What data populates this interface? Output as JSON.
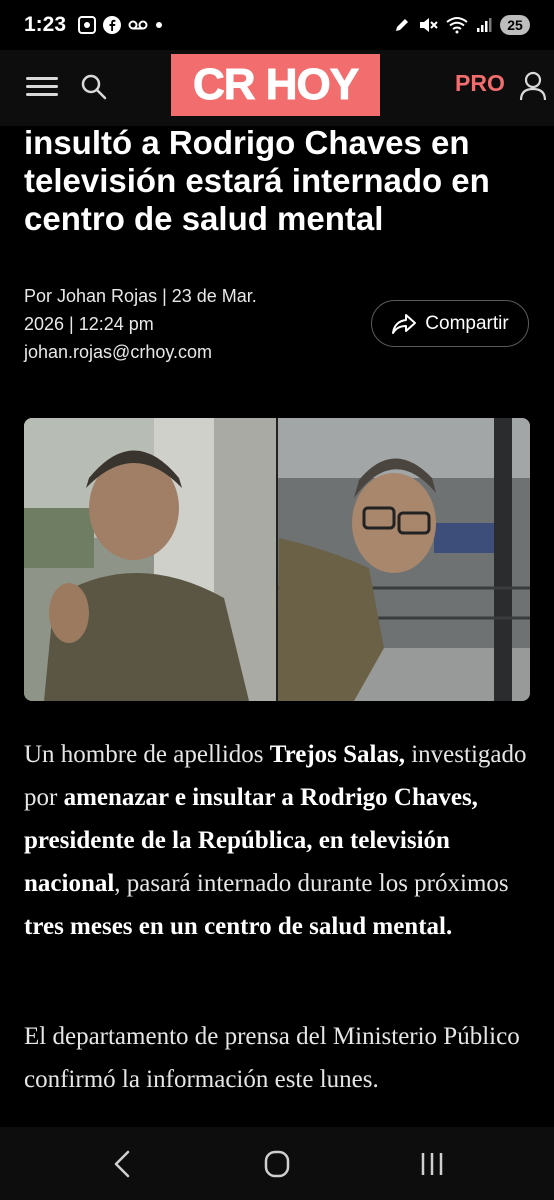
{
  "status_bar": {
    "time": "1:23",
    "battery": "25"
  },
  "header": {
    "logo_text": "CR HOY",
    "pro_label": "PRO"
  },
  "article": {
    "headline": "insultó a Rodrigo Chaves en televisión estará internado en centro de salud mental",
    "byline_line1": "Por Johan Rojas | 23 de Mar.",
    "byline_line2": "2026 | 12:24 pm",
    "byline_email": "johan.rojas@crhoy.com",
    "share_label": "Compartir",
    "p1": [
      {
        "text": "Un hombre de apellidos ",
        "bold": false
      },
      {
        "text": "Trejos Salas,",
        "bold": true
      },
      {
        "text": " investigado por ",
        "bold": false
      },
      {
        "text": "amenazar e insultar a Rodrigo Chaves, presidente de la República, en televisión nacional",
        "bold": true
      },
      {
        "text": ", pasará internado durante los próximos ",
        "bold": false
      },
      {
        "text": "tres meses en un centro de salud mental.",
        "bold": true
      }
    ],
    "p2": "El departamento de prensa del Ministerio Público confirmó la información este lunes."
  },
  "icons": {
    "menu": "hamburger-menu-icon",
    "search": "search-icon",
    "user": "user-icon",
    "share": "share-arrow-icon",
    "back": "back-icon",
    "home": "home-icon",
    "recents": "recents-icon"
  },
  "colors": {
    "brand": "#f26d6d",
    "background": "#000000"
  }
}
